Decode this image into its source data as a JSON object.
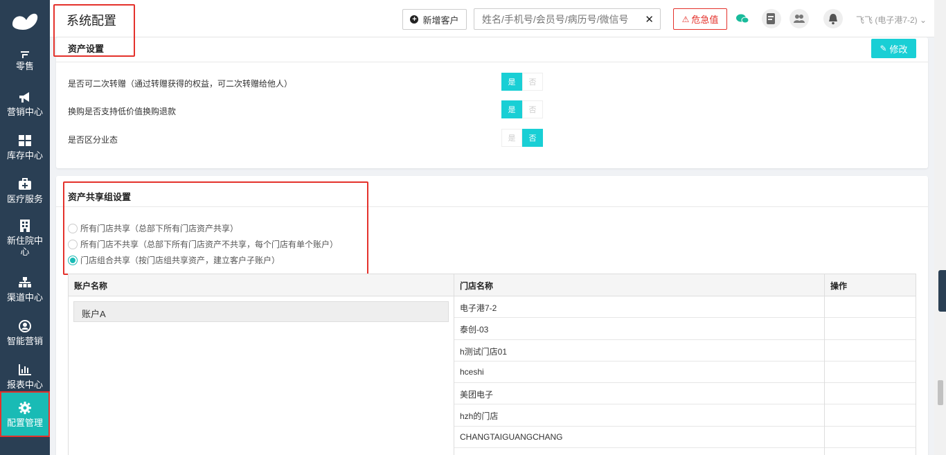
{
  "sidebar": {
    "items": [
      {
        "label": "零售",
        "icon": "retail-icon"
      },
      {
        "label": "营销中心",
        "icon": "megaphone-icon"
      },
      {
        "label": "库存中心",
        "icon": "grid-icon"
      },
      {
        "label": "医疗服务",
        "icon": "medical-kit-icon"
      },
      {
        "label": "新住院中心",
        "icon": "hospital-icon"
      },
      {
        "label": "渠道中心",
        "icon": "sitemap-icon"
      },
      {
        "label": "智能营销",
        "icon": "user-circle-icon"
      },
      {
        "label": "报表中心",
        "icon": "bar-chart-icon"
      },
      {
        "label": "配置管理",
        "icon": "gear-icon"
      }
    ],
    "active_index": 8
  },
  "header": {
    "title": "系统配置",
    "new_customer_label": "新增客户",
    "search_placeholder": "姓名/手机号/会员号/病历号/微信号",
    "critical_label": "危急值",
    "user_label": "飞飞 (电子港7-2)"
  },
  "asset_settings": {
    "title": "资产设置",
    "edit_label": "修改",
    "options": [
      {
        "label": "是否可二次转赠（通过转赠获得的权益，可二次转赠给他人）",
        "yes": "是",
        "no": "否",
        "value": "yes"
      },
      {
        "label": "换购是否支持低价值换购退款",
        "yes": "是",
        "no": "否",
        "value": "yes"
      },
      {
        "label": "是否区分业态",
        "yes": "是",
        "no": "否",
        "value": "no"
      }
    ]
  },
  "share_group": {
    "title": "资产共享组设置",
    "radios": [
      {
        "label": "所有门店共享（总部下所有门店资产共享）",
        "checked": false
      },
      {
        "label": "所有门店不共享（总部下所有门店资产不共享，每个门店有单个账户）",
        "checked": false
      },
      {
        "label": "门店组合共享（按门店组共享资产，建立客户子账户）",
        "checked": true
      }
    ],
    "table": {
      "headers": [
        "账户名称",
        "门店名称",
        "操作"
      ],
      "account": "账户A",
      "stores": [
        "电子港7-2",
        "泰创-03",
        "h测试门店01",
        "hceshi",
        "美团电子",
        "hzh的门店",
        "CHANGTAIGUANGCHANG"
      ]
    }
  }
}
